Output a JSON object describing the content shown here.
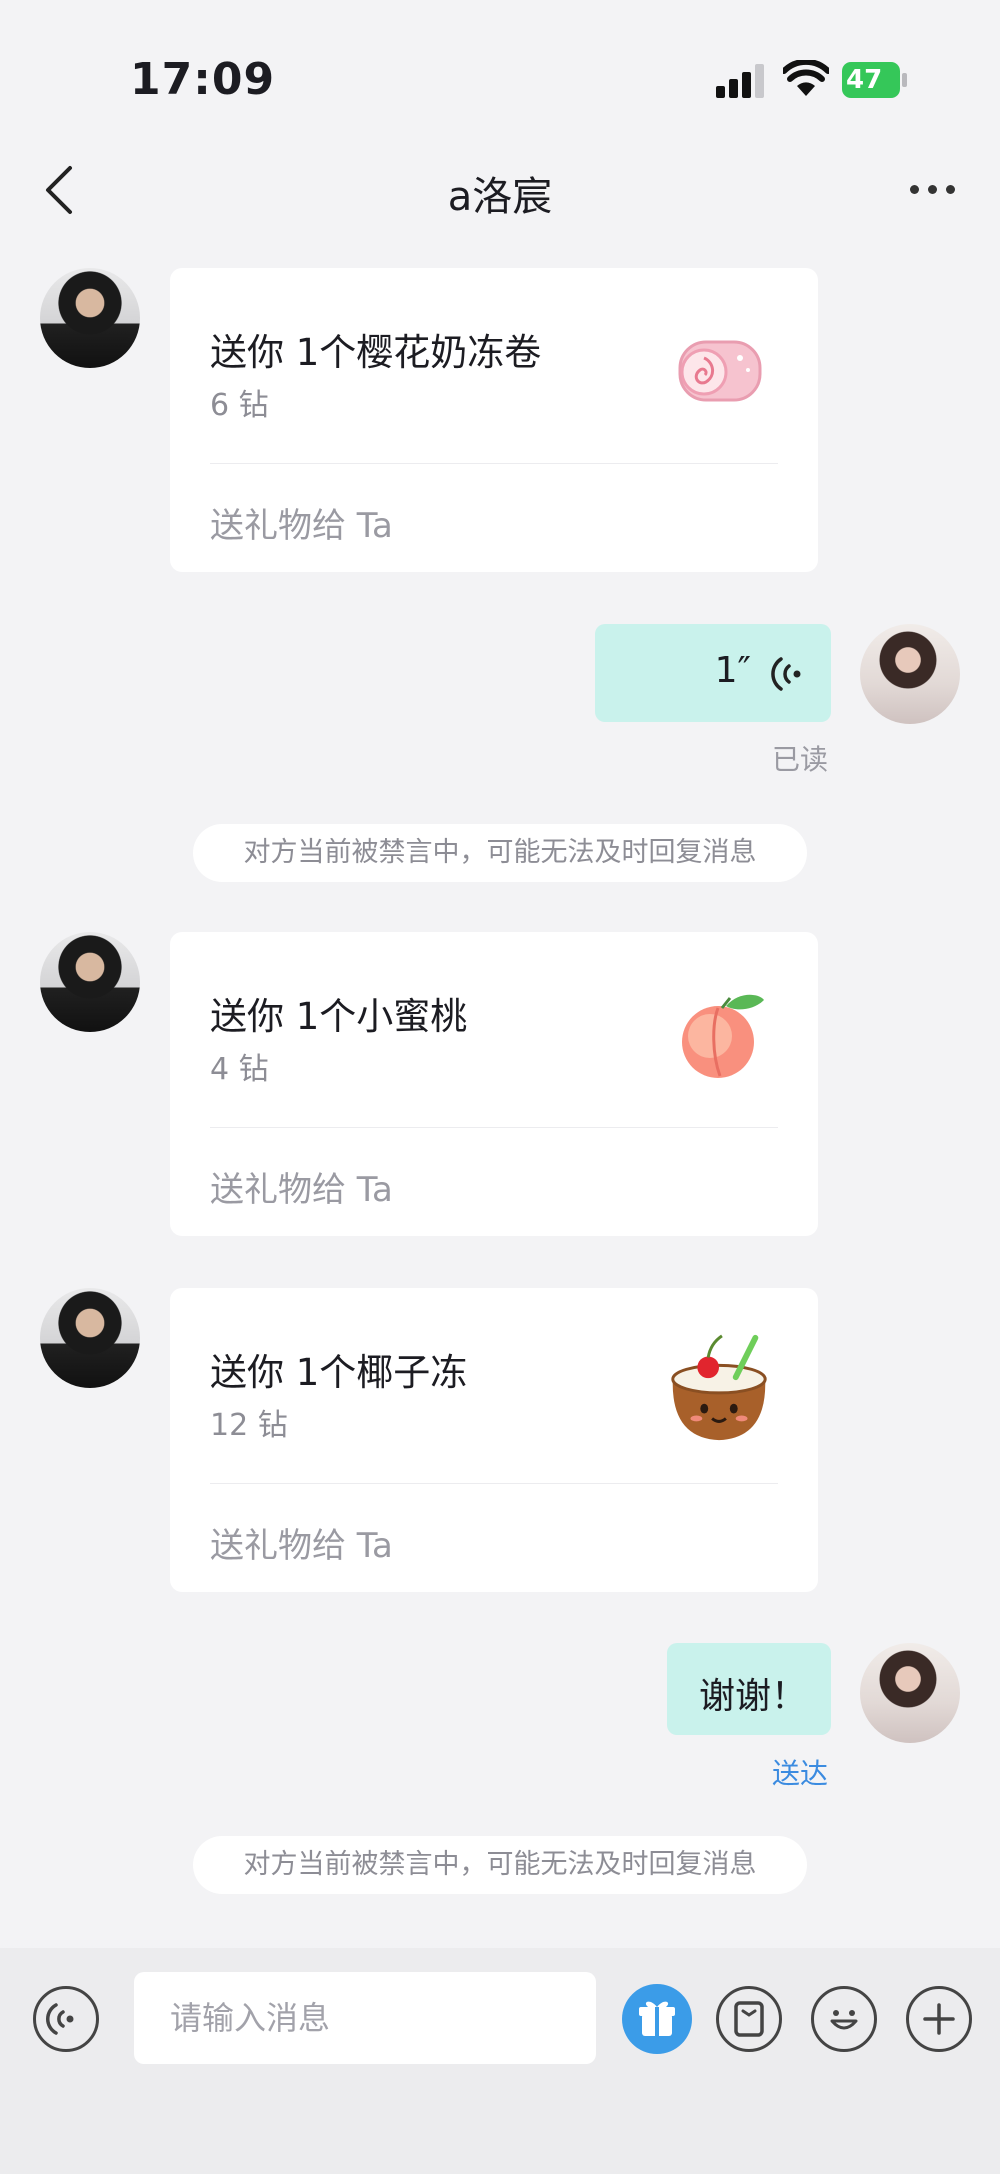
{
  "status_bar": {
    "time": "17:09",
    "battery": "47"
  },
  "header": {
    "title": "a洛宸"
  },
  "messages": [
    {
      "type": "gift",
      "title": "送你 1个樱花奶冻卷",
      "price": "6 钻",
      "action": "送礼物给 Ta",
      "icon": "sakura-roll-icon"
    },
    {
      "type": "voice",
      "duration": "1″",
      "status": "已读"
    },
    {
      "type": "notice",
      "text": "对方当前被禁言中，可能无法及时回复消息"
    },
    {
      "type": "gift",
      "title": "送你 1个小蜜桃",
      "price": "4 钻",
      "action": "送礼物给 Ta",
      "icon": "peach-icon"
    },
    {
      "type": "gift",
      "title": "送你 1个椰子冻",
      "price": "12 钻",
      "action": "送礼物给 Ta",
      "icon": "coconut-icon"
    },
    {
      "type": "text",
      "text": "谢谢！",
      "status": "送达"
    },
    {
      "type": "notice",
      "text": "对方当前被禁言中，可能无法及时回复消息"
    }
  ],
  "input": {
    "placeholder": "请输入消息"
  },
  "colors": {
    "outgoing_bubble": "#c9f2ec",
    "sent_status": "#3b8be0",
    "gift_button": "#3b9ce8"
  }
}
